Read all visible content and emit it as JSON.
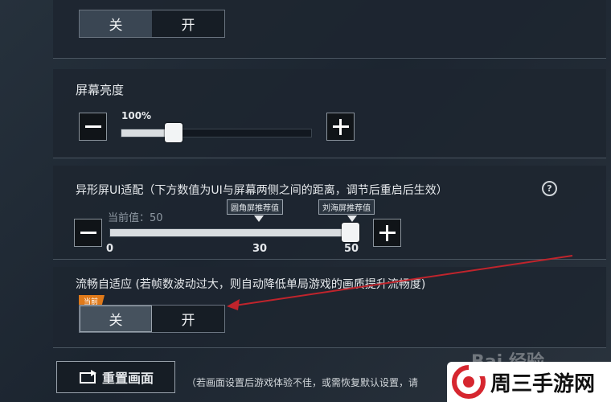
{
  "toggle_top": {
    "off": "关",
    "on": "开"
  },
  "brightness": {
    "title": "屏幕亮度",
    "value_label": "100%",
    "value": 100
  },
  "notch": {
    "title": "异形屏UI适配（下方数值为UI与屏幕两侧之间的距离，调节后重启后生效）",
    "help": "?",
    "current_label": "当前值：50",
    "marker_round": "圆角屏推荐值",
    "marker_notch": "刘海屏推荐值",
    "tick_min": "0",
    "tick_mid": "30",
    "tick_max": "50",
    "value": 50
  },
  "smooth": {
    "title": "流畅自适应 (若帧数波动过大，则自动降低单局游戏的画质提升流畅度)",
    "current_tag": "当前",
    "off": "关",
    "on": "开"
  },
  "reset": {
    "label": "重置画面",
    "hint": "（若画面设置后游戏体验不佳，或需恢复默认设置，请"
  },
  "watermark": {
    "baidu": "Bai  经验",
    "site": "周三手游网"
  },
  "colors": {
    "accent_tag": "#e07a1a",
    "arrow": "#c0242c",
    "logo_red": "#d6262f"
  }
}
